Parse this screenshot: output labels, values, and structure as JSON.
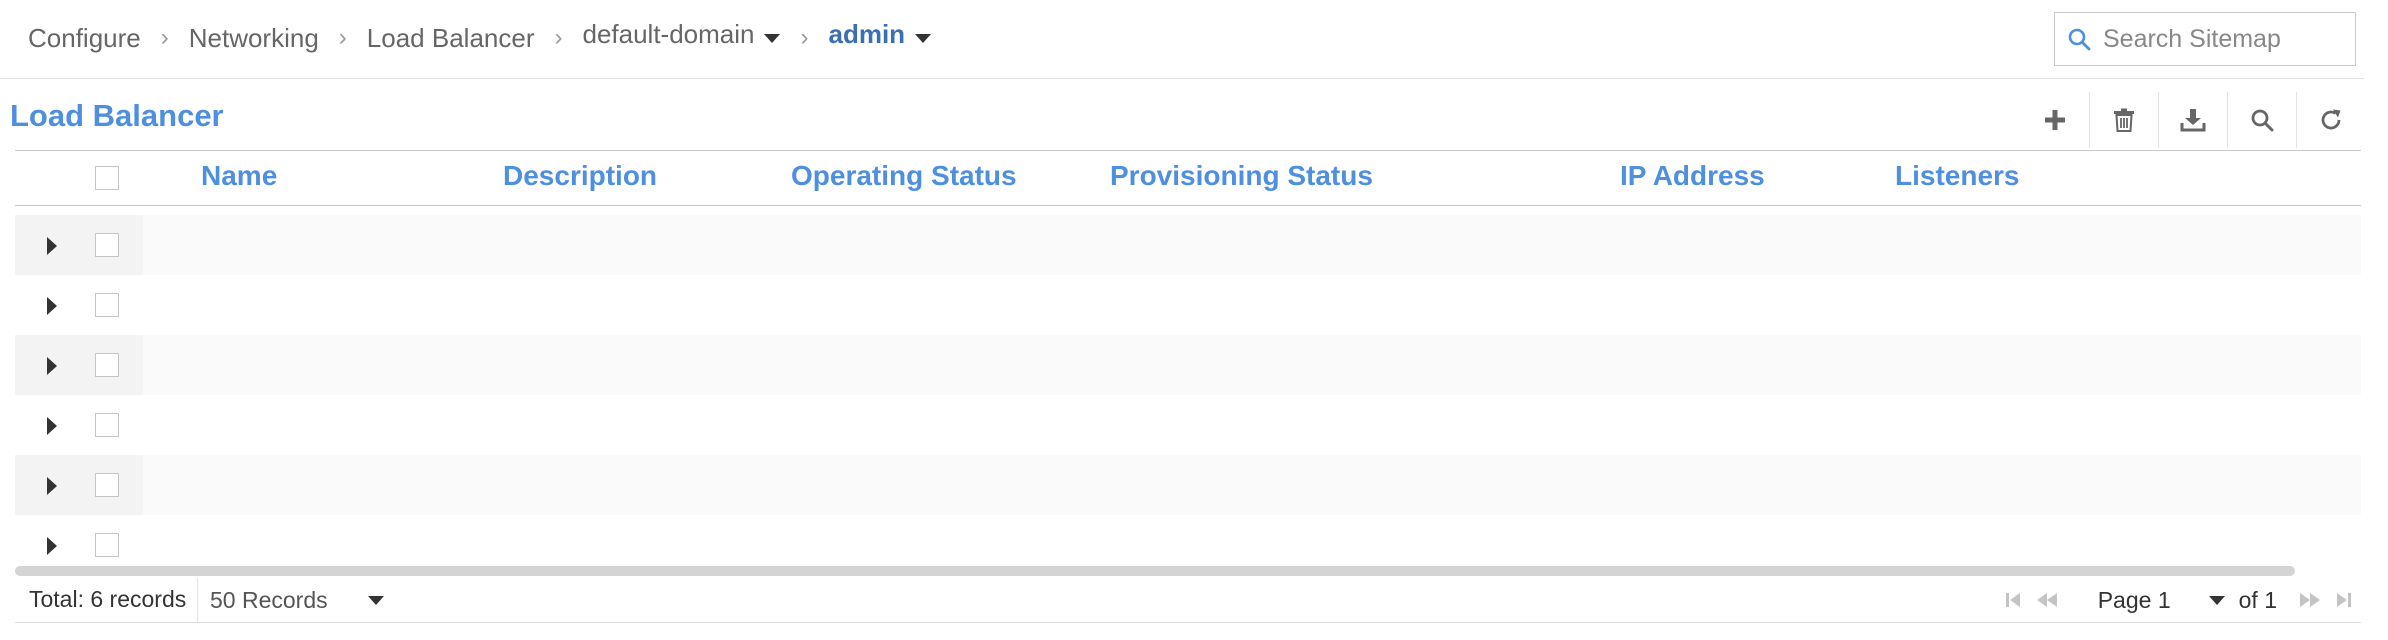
{
  "breadcrumb": {
    "items": [
      {
        "label": "Configure"
      },
      {
        "label": "Networking"
      },
      {
        "label": "Load Balancer"
      },
      {
        "label": "default-domain"
      },
      {
        "label": "admin"
      }
    ]
  },
  "search": {
    "placeholder": "Search Sitemap"
  },
  "page": {
    "title": "Load Balancer"
  },
  "toolbar": {
    "icons": [
      "plus-icon",
      "trash-icon",
      "download-icon",
      "search-icon",
      "refresh-icon"
    ]
  },
  "table": {
    "columns": [
      "Name",
      "Description",
      "Operating Status",
      "Provisioning Status",
      "IP Address",
      "Listeners"
    ],
    "rows": [
      {},
      {},
      {},
      {},
      {},
      {}
    ]
  },
  "footer": {
    "total": "Total: 6 records",
    "page_size": "50 Records",
    "page_label": "Page 1",
    "of_label": "of 1"
  },
  "colors": {
    "accent": "#4f8fe0",
    "active_crumb": "#3a6fb0"
  }
}
